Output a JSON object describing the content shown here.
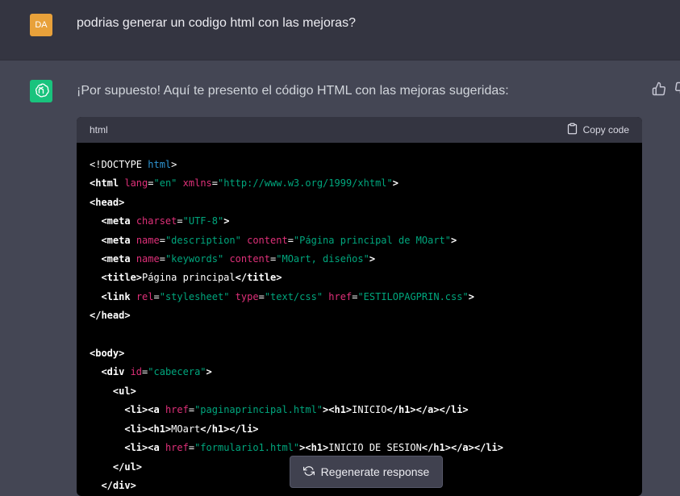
{
  "user": {
    "avatar_text": "DA",
    "message": "podrias generar un codigo html con las mejoras?"
  },
  "assistant": {
    "message": "¡Por supuesto! Aquí te presento el código HTML con las mejoras sugeridas:"
  },
  "code": {
    "language": "html",
    "copy_label": "Copy code",
    "lines": [
      [
        {
          "t": "doc",
          "v": "<!DOCTYPE "
        },
        {
          "t": "kw",
          "v": "html"
        },
        {
          "t": "doc",
          "v": ">"
        }
      ],
      [
        {
          "t": "tag",
          "v": "<html "
        },
        {
          "t": "attr",
          "v": "lang"
        },
        {
          "t": "doc",
          "v": "="
        },
        {
          "t": "str",
          "v": "\"en\""
        },
        {
          "t": "doc",
          "v": " "
        },
        {
          "t": "attr",
          "v": "xmlns"
        },
        {
          "t": "doc",
          "v": "="
        },
        {
          "t": "str",
          "v": "\"http://www.w3.org/1999/xhtml\""
        },
        {
          "t": "tag",
          "v": ">"
        }
      ],
      [
        {
          "t": "tag",
          "v": "<head>"
        }
      ],
      [
        {
          "t": "doc",
          "v": "  "
        },
        {
          "t": "tag",
          "v": "<meta "
        },
        {
          "t": "attr",
          "v": "charset"
        },
        {
          "t": "doc",
          "v": "="
        },
        {
          "t": "str",
          "v": "\"UTF-8\""
        },
        {
          "t": "tag",
          "v": ">"
        }
      ],
      [
        {
          "t": "doc",
          "v": "  "
        },
        {
          "t": "tag",
          "v": "<meta "
        },
        {
          "t": "attr",
          "v": "name"
        },
        {
          "t": "doc",
          "v": "="
        },
        {
          "t": "str",
          "v": "\"description\""
        },
        {
          "t": "doc",
          "v": " "
        },
        {
          "t": "attr",
          "v": "content"
        },
        {
          "t": "doc",
          "v": "="
        },
        {
          "t": "str",
          "v": "\"Página principal de MOart\""
        },
        {
          "t": "tag",
          "v": ">"
        }
      ],
      [
        {
          "t": "doc",
          "v": "  "
        },
        {
          "t": "tag",
          "v": "<meta "
        },
        {
          "t": "attr",
          "v": "name"
        },
        {
          "t": "doc",
          "v": "="
        },
        {
          "t": "str",
          "v": "\"keywords\""
        },
        {
          "t": "doc",
          "v": " "
        },
        {
          "t": "attr",
          "v": "content"
        },
        {
          "t": "doc",
          "v": "="
        },
        {
          "t": "str",
          "v": "\"MOart, diseños\""
        },
        {
          "t": "tag",
          "v": ">"
        }
      ],
      [
        {
          "t": "doc",
          "v": "  "
        },
        {
          "t": "tag",
          "v": "<title>"
        },
        {
          "t": "doc",
          "v": "Página principal"
        },
        {
          "t": "tag",
          "v": "</title>"
        }
      ],
      [
        {
          "t": "doc",
          "v": "  "
        },
        {
          "t": "tag",
          "v": "<link "
        },
        {
          "t": "attr",
          "v": "rel"
        },
        {
          "t": "doc",
          "v": "="
        },
        {
          "t": "str",
          "v": "\"stylesheet\""
        },
        {
          "t": "doc",
          "v": " "
        },
        {
          "t": "attr",
          "v": "type"
        },
        {
          "t": "doc",
          "v": "="
        },
        {
          "t": "str",
          "v": "\"text/css\""
        },
        {
          "t": "doc",
          "v": " "
        },
        {
          "t": "attr",
          "v": "href"
        },
        {
          "t": "doc",
          "v": "="
        },
        {
          "t": "str",
          "v": "\"ESTILOPAGPRIN.css\""
        },
        {
          "t": "tag",
          "v": ">"
        }
      ],
      [
        {
          "t": "tag",
          "v": "</head>"
        }
      ],
      [
        {
          "t": "doc",
          "v": ""
        }
      ],
      [
        {
          "t": "tag",
          "v": "<body>"
        }
      ],
      [
        {
          "t": "doc",
          "v": "  "
        },
        {
          "t": "tag",
          "v": "<div "
        },
        {
          "t": "attr",
          "v": "id"
        },
        {
          "t": "doc",
          "v": "="
        },
        {
          "t": "str",
          "v": "\"cabecera\""
        },
        {
          "t": "tag",
          "v": ">"
        }
      ],
      [
        {
          "t": "doc",
          "v": "    "
        },
        {
          "t": "tag",
          "v": "<ul>"
        }
      ],
      [
        {
          "t": "doc",
          "v": "      "
        },
        {
          "t": "tag",
          "v": "<li><a "
        },
        {
          "t": "attr",
          "v": "href"
        },
        {
          "t": "doc",
          "v": "="
        },
        {
          "t": "str",
          "v": "\"paginaprincipal.html\""
        },
        {
          "t": "tag",
          "v": "><h1>"
        },
        {
          "t": "doc",
          "v": "INICIO"
        },
        {
          "t": "tag",
          "v": "</h1></a></li>"
        }
      ],
      [
        {
          "t": "doc",
          "v": "      "
        },
        {
          "t": "tag",
          "v": "<li><h1>"
        },
        {
          "t": "doc",
          "v": "MOart"
        },
        {
          "t": "tag",
          "v": "</h1></li>"
        }
      ],
      [
        {
          "t": "doc",
          "v": "      "
        },
        {
          "t": "tag",
          "v": "<li><a "
        },
        {
          "t": "attr",
          "v": "href"
        },
        {
          "t": "doc",
          "v": "="
        },
        {
          "t": "str",
          "v": "\"formulario1.html\""
        },
        {
          "t": "tag",
          "v": "><h1>"
        },
        {
          "t": "doc",
          "v": "INICIO DE SESION"
        },
        {
          "t": "tag",
          "v": "</h1></a></li>"
        }
      ],
      [
        {
          "t": "doc",
          "v": "    "
        },
        {
          "t": "tag",
          "v": "</ul>"
        }
      ],
      [
        {
          "t": "doc",
          "v": "  "
        },
        {
          "t": "tag",
          "v": "</div>"
        }
      ]
    ]
  },
  "regenerate": {
    "label": "Regenerate response"
  },
  "icons": {
    "assistant_logo": "openai-logo-icon",
    "copy": "clipboard-icon",
    "thumbs_up": "thumbs-up-icon",
    "thumbs_down": "thumbs-down-icon",
    "regenerate": "refresh-icon"
  }
}
